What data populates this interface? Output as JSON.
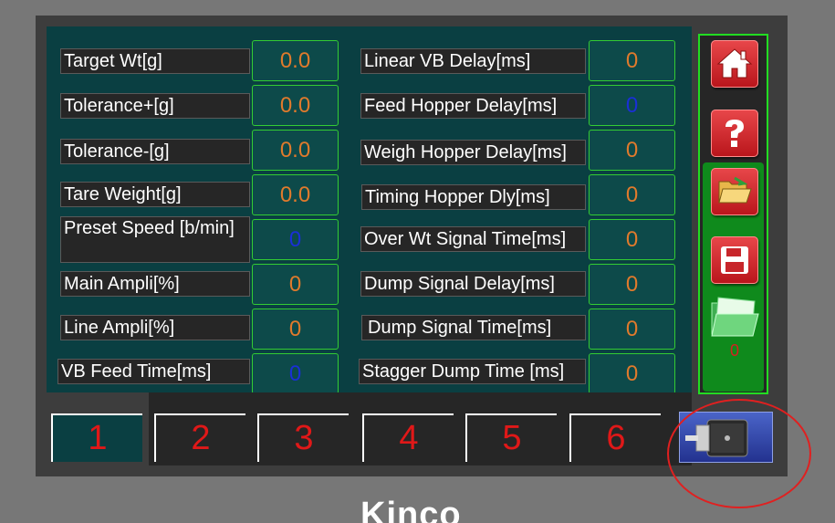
{
  "left_params": [
    {
      "label": "Target Wt[g]",
      "value": "0.0"
    },
    {
      "label": "Tolerance+[g]",
      "value": "0.0"
    },
    {
      "label": "Tolerance-[g]",
      "value": "0.0"
    },
    {
      "label": "Tare Weight[g]",
      "value": "0.0"
    },
    {
      "label": "Preset Speed [b/min]",
      "value": "0"
    },
    {
      "label": "Main Ampli[%]",
      "value": "0"
    },
    {
      "label": "Line Ampli[%]",
      "value": "0"
    },
    {
      "label": "VB Feed Time[ms]",
      "value": "0"
    }
  ],
  "right_params": [
    {
      "label": "Linear VB Delay[ms]",
      "value": "0"
    },
    {
      "label": "Feed Hopper Delay[ms]",
      "value": "0"
    },
    {
      "label": "Weigh Hopper Delay[ms]",
      "value": "0"
    },
    {
      "label": "Timing Hopper Dly[ms]",
      "value": "0"
    },
    {
      "label": "Over Wt Signal Time[ms]",
      "value": "0"
    },
    {
      "label": "Dump Signal Delay[ms]",
      "value": "0"
    },
    {
      "label": "Dump Signal Time[ms]",
      "value": "0"
    },
    {
      "label": "Stagger Dump Time [ms]",
      "value": "0"
    }
  ],
  "sidebar": {
    "folder_count": "0",
    "icons": [
      "home-icon",
      "help-icon",
      "open-folder-icon",
      "save-icon",
      "file-folder-icon"
    ]
  },
  "tabs": [
    "1",
    "2",
    "3",
    "4",
    "5",
    "6"
  ],
  "active_tab": "1",
  "brand": "Kinco",
  "colors": {
    "panel": "#0a3f42",
    "value_orange": "#e07a2c",
    "value_blue": "#1a2fd6",
    "tab_number_red": "#e01818",
    "sidebar_green": "#0f8a1c",
    "button_red": "#c8262b",
    "highlight_circle": "#e02020"
  }
}
